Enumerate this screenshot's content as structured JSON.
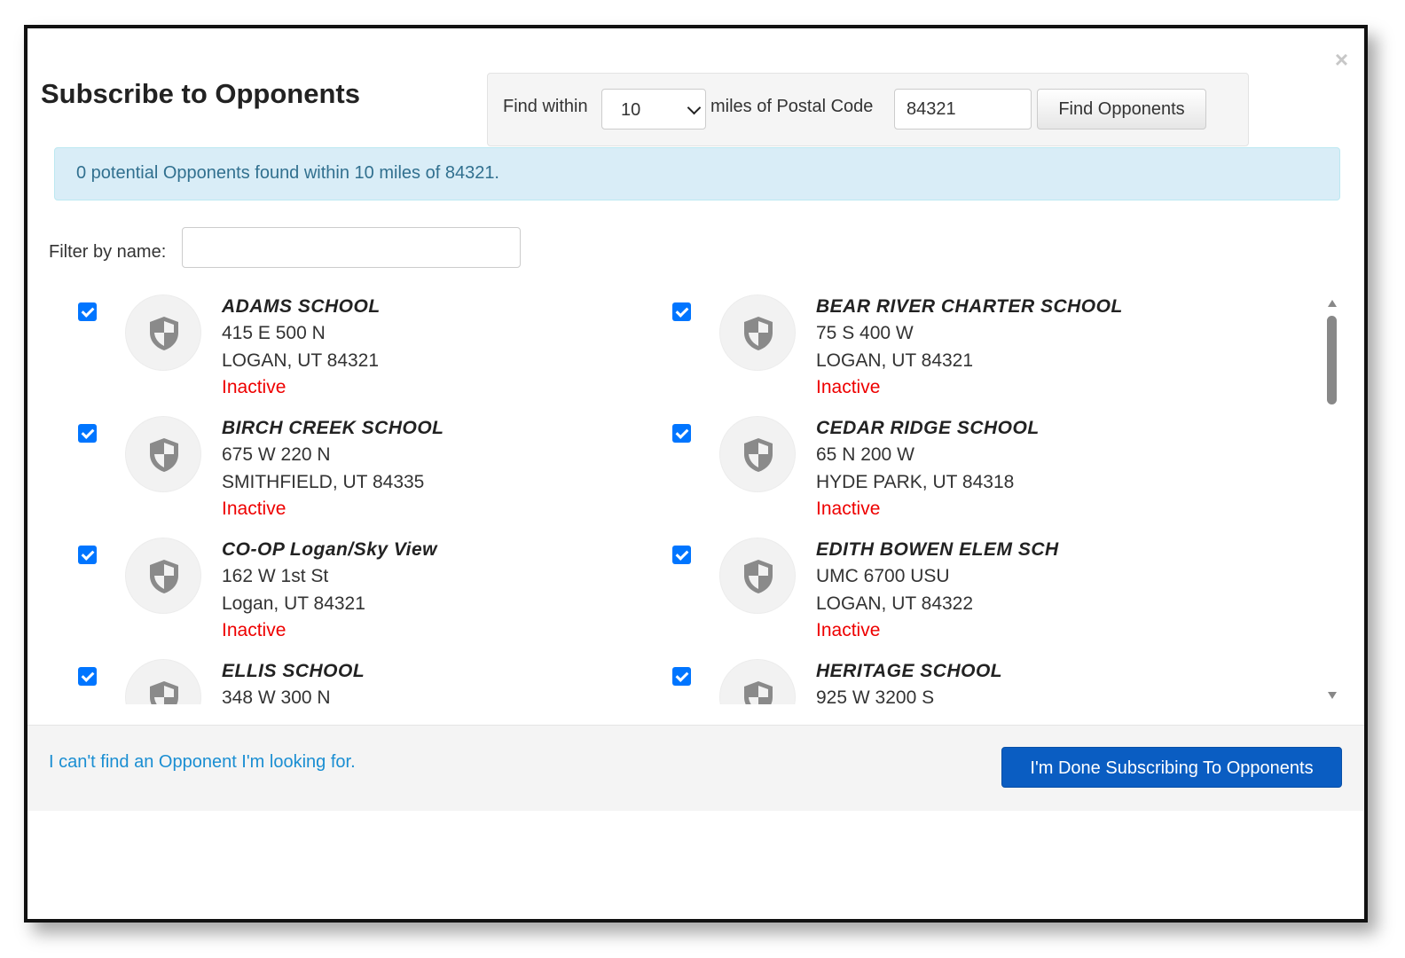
{
  "dialog": {
    "title": "Subscribe to Opponents",
    "close_label": "×"
  },
  "search": {
    "find_within_label": "Find within",
    "radius_selected": "10",
    "miles_label": "miles of Postal Code",
    "postal_code": "84321",
    "button_label": "Find Opponents"
  },
  "alert": {
    "message": "0 potential Opponents found within 10 miles of 84321."
  },
  "filter": {
    "label": "Filter by name:",
    "value": ""
  },
  "icons": {
    "close": "close-icon",
    "dropdown": "chevron-down-icon",
    "opponent_logo": "shield-icon",
    "checkbox": "checkmark-icon"
  },
  "colors": {
    "checkbox": "#0075ff",
    "inactive": "#ee0000",
    "primary_button": "#0a5dc2",
    "alert_bg": "#d9edf7",
    "alert_text": "#31708f",
    "link": "#1a8ed2"
  },
  "opponents": [
    {
      "name": "ADAMS SCHOOL",
      "address": "415 E 500 N",
      "city": "LOGAN, UT 84321",
      "status": "Inactive",
      "checked": true
    },
    {
      "name": "BEAR RIVER CHARTER SCHOOL",
      "address": "75 S 400 W",
      "city": "LOGAN, UT 84321",
      "status": "Inactive",
      "checked": true
    },
    {
      "name": "BIRCH CREEK SCHOOL",
      "address": "675 W 220 N",
      "city": "SMITHFIELD, UT 84335",
      "status": "Inactive",
      "checked": true
    },
    {
      "name": "CEDAR RIDGE SCHOOL",
      "address": "65 N 200 W",
      "city": "HYDE PARK, UT 84318",
      "status": "Inactive",
      "checked": true
    },
    {
      "name": "CO-OP Logan/Sky View",
      "address": "162 W 1st St",
      "city": "Logan, UT 84321",
      "status": "Inactive",
      "checked": true
    },
    {
      "name": "EDITH BOWEN ELEM SCH",
      "address": "UMC 6700 USU",
      "city": "LOGAN, UT 84322",
      "status": "Inactive",
      "checked": true
    },
    {
      "name": "ELLIS SCHOOL",
      "address": "348 W 300 N",
      "city": "",
      "status": "",
      "checked": true
    },
    {
      "name": "HERITAGE SCHOOL",
      "address": "925 W 3200 S",
      "city": "",
      "status": "",
      "checked": true
    }
  ],
  "footer": {
    "link_label": "I can't find an Opponent I'm looking for.",
    "done_label": "I'm Done Subscribing To Opponents"
  }
}
